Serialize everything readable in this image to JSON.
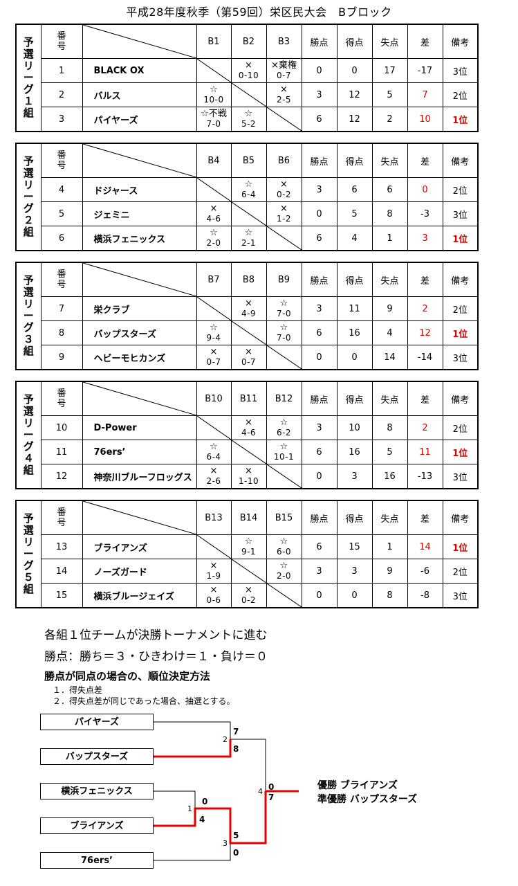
{
  "title": "平成28年度秋季（第59回）栄区民大会　Bブロック",
  "headers": {
    "no": [
      "番",
      "号"
    ],
    "pts": "勝点",
    "gf": "得点",
    "ga": "失点",
    "diff": "差",
    "note": "備考"
  },
  "groups": [
    {
      "label": [
        "予",
        "選",
        "リ",
        "ー",
        "グ",
        "１",
        "組"
      ],
      "cols": [
        "B1",
        "B2",
        "B3"
      ],
      "rows": [
        {
          "no": "1",
          "name": "BLACK OX",
          "r": [
            null,
            [
              "×",
              "0-10"
            ],
            [
              "×棄権",
              "0-7"
            ]
          ],
          "pts": "0",
          "gf": "0",
          "ga": "17",
          "diff": "-17",
          "note": "3位",
          "diff_red": false,
          "note_red": false
        },
        {
          "no": "2",
          "name": "バルス",
          "r": [
            [
              "☆",
              "10-0"
            ],
            null,
            [
              "×",
              "2-5"
            ]
          ],
          "pts": "3",
          "gf": "12",
          "ga": "5",
          "diff": "7",
          "note": "2位",
          "diff_red": true,
          "note_red": false
        },
        {
          "no": "3",
          "name": "パイヤーズ",
          "r": [
            [
              "☆不戦",
              "7-0"
            ],
            [
              "☆",
              "5-2"
            ],
            null
          ],
          "pts": "6",
          "gf": "12",
          "ga": "2",
          "diff": "10",
          "note": "1位",
          "diff_red": true,
          "note_red": true
        }
      ]
    },
    {
      "label": [
        "予",
        "選",
        "リ",
        "ー",
        "グ",
        "２",
        "組"
      ],
      "cols": [
        "B4",
        "B5",
        "B6"
      ],
      "rows": [
        {
          "no": "4",
          "name": "ドジャース",
          "r": [
            null,
            [
              "☆",
              "6-4"
            ],
            [
              "×",
              "0-2"
            ]
          ],
          "pts": "3",
          "gf": "6",
          "ga": "6",
          "diff": "0",
          "note": "2位",
          "diff_red": true,
          "note_red": false
        },
        {
          "no": "5",
          "name": "ジェミニ",
          "r": [
            [
              "×",
              "4-6"
            ],
            null,
            [
              "×",
              "1-2"
            ]
          ],
          "pts": "0",
          "gf": "5",
          "ga": "8",
          "diff": "-3",
          "note": "3位",
          "diff_red": false,
          "note_red": false
        },
        {
          "no": "6",
          "name": "横浜フェニックス",
          "r": [
            [
              "☆",
              "2-0"
            ],
            [
              "☆",
              "2-1"
            ],
            null
          ],
          "pts": "6",
          "gf": "4",
          "ga": "1",
          "diff": "3",
          "note": "1位",
          "diff_red": true,
          "note_red": true
        }
      ]
    },
    {
      "label": [
        "予",
        "選",
        "リ",
        "ー",
        "グ",
        "３",
        "組"
      ],
      "cols": [
        "B7",
        "B8",
        "B9"
      ],
      "rows": [
        {
          "no": "7",
          "name": "栄クラブ",
          "r": [
            null,
            [
              "×",
              "4-9"
            ],
            [
              "☆",
              "7-0"
            ]
          ],
          "pts": "3",
          "gf": "11",
          "ga": "9",
          "diff": "2",
          "note": "2位",
          "diff_red": true,
          "note_red": false
        },
        {
          "no": "8",
          "name": "バップスターズ",
          "r": [
            [
              "☆",
              "9-4"
            ],
            null,
            [
              "☆",
              "7-0"
            ]
          ],
          "pts": "6",
          "gf": "16",
          "ga": "4",
          "diff": "12",
          "note": "1位",
          "diff_red": true,
          "note_red": true
        },
        {
          "no": "9",
          "name": "ヘビーモヒカンズ",
          "r": [
            [
              "×",
              "0-7"
            ],
            [
              "×",
              "0-7"
            ],
            null
          ],
          "pts": "0",
          "gf": "0",
          "ga": "14",
          "diff": "-14",
          "note": "3位",
          "diff_red": false,
          "note_red": false
        }
      ]
    },
    {
      "label": [
        "予",
        "選",
        "リ",
        "ー",
        "グ",
        "４",
        "組"
      ],
      "cols": [
        "B10",
        "B11",
        "B12"
      ],
      "rows": [
        {
          "no": "10",
          "name": "D-Power",
          "r": [
            null,
            [
              "×",
              "4-6"
            ],
            [
              "☆",
              "6-2"
            ]
          ],
          "pts": "3",
          "gf": "10",
          "ga": "8",
          "diff": "2",
          "note": "2位",
          "diff_red": true,
          "note_red": false
        },
        {
          "no": "11",
          "name": "76ers’",
          "r": [
            [
              "☆",
              "6-4"
            ],
            null,
            [
              "☆",
              "10-1"
            ]
          ],
          "pts": "6",
          "gf": "16",
          "ga": "5",
          "diff": "11",
          "note": "1位",
          "diff_red": true,
          "note_red": true
        },
        {
          "no": "12",
          "name": "神奈川ブルーフロッグス",
          "r": [
            [
              "×",
              "2-6"
            ],
            [
              "×",
              "1-10"
            ],
            null
          ],
          "pts": "0",
          "gf": "3",
          "ga": "16",
          "diff": "-13",
          "note": "3位",
          "diff_red": false,
          "note_red": false
        }
      ]
    },
    {
      "label": [
        "予",
        "選",
        "リ",
        "ー",
        "グ",
        "５",
        "組"
      ],
      "cols": [
        "B13",
        "B14",
        "B15"
      ],
      "rows": [
        {
          "no": "13",
          "name": "ブライアンズ",
          "r": [
            null,
            [
              "☆",
              "9-1"
            ],
            [
              "☆",
              "6-0"
            ]
          ],
          "pts": "6",
          "gf": "15",
          "ga": "1",
          "diff": "14",
          "note": "1位",
          "diff_red": true,
          "note_red": true
        },
        {
          "no": "14",
          "name": "ノーズガード",
          "r": [
            [
              "×",
              "1-9"
            ],
            null,
            [
              "☆",
              "2-0"
            ]
          ],
          "pts": "3",
          "gf": "3",
          "ga": "9",
          "diff": "-6",
          "note": "2位",
          "diff_red": false,
          "note_red": false
        },
        {
          "no": "15",
          "name": "横浜ブルージェイズ",
          "r": [
            [
              "×",
              "0-6"
            ],
            [
              "×",
              "0-2"
            ],
            null
          ],
          "pts": "0",
          "gf": "0",
          "ga": "8",
          "diff": "-8",
          "note": "3位",
          "diff_red": false,
          "note_red": false
        }
      ]
    }
  ],
  "notes": {
    "line1": "各組１位チームが決勝トーナメントに進む",
    "line2": "勝点：勝ち＝３・ひきわけ＝１・負け＝０",
    "line3": "勝点が同点の場合の、順位決定方法",
    "line4": "１．得失点差",
    "line5": "２．得失点差が同じであった場合、抽選とする。"
  },
  "bracket": {
    "teams": [
      "パイヤーズ",
      "バップスターズ",
      "横浜フェニックス",
      "ブライアンズ",
      "76ers’"
    ],
    "match_labels": [
      "2",
      "1",
      "3",
      "4"
    ],
    "scores": {
      "m2_top": "7",
      "m2_bottom": "8",
      "m1_top": "0",
      "m1_bottom": "4",
      "m3_top": "5",
      "m3_bottom": "0",
      "m4_top": "0",
      "m4_bottom": "7"
    },
    "result_winner": "優勝 ブライアンズ",
    "result_runnerup": "準優勝 バップスターズ",
    "win_color": "#e00000"
  }
}
